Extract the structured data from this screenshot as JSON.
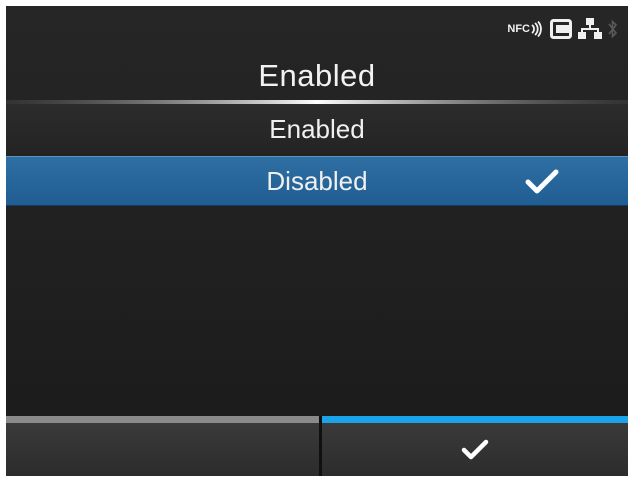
{
  "status_icons": [
    "nfc-icon",
    "sd-card-icon",
    "network-icon",
    "bluetooth-icon"
  ],
  "status_text": {
    "nfc": "NFC"
  },
  "title": "Enabled",
  "options": [
    {
      "label": "Enabled",
      "selected": false
    },
    {
      "label": "Disabled",
      "selected": true
    }
  ],
  "softkeys": {
    "left": {
      "icon": "",
      "indicator_color": "#8a8a8a"
    },
    "right": {
      "icon": "checkmark-icon",
      "indicator_color": "#1aa3e8"
    }
  },
  "colors": {
    "selected_row": "#2566a0",
    "accent": "#1aa3e8",
    "background": "#222222"
  }
}
